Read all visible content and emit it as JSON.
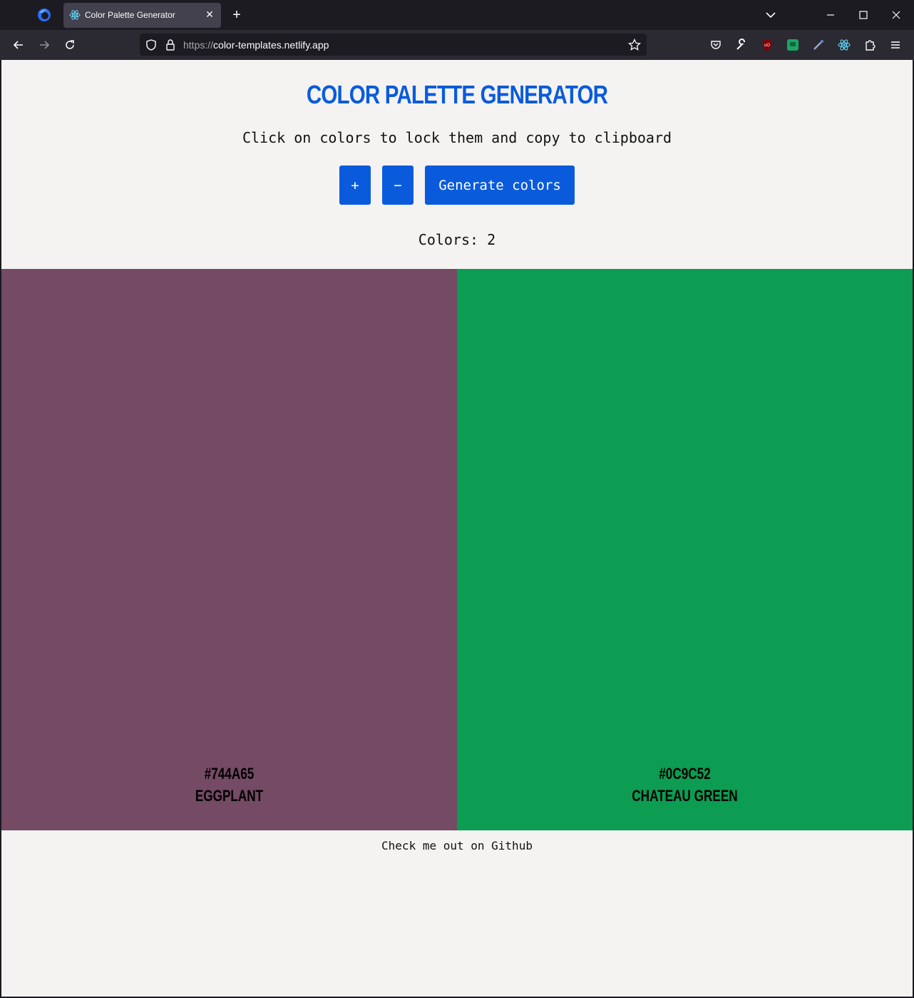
{
  "browser": {
    "tab_title": "Color Palette Generator",
    "url_scheme": "https://",
    "url_host": "color-templates.netlify.app"
  },
  "page": {
    "title": "Color Palette Generator",
    "subtitle": "Click on colors to lock them and copy to clipboard",
    "buttons": {
      "add": "+",
      "remove": "−",
      "generate": "Generate colors"
    },
    "count_label": "Colors:",
    "count_value": "2",
    "swatches": [
      {
        "hex": "#744A65",
        "name": "Eggplant",
        "color": "#744a65"
      },
      {
        "hex": "#0C9C52",
        "name": "Chateau Green",
        "color": "#0c9c52"
      }
    ],
    "footer_link": "Check me out on Github"
  },
  "colors": {
    "accent": "#0a5bdc",
    "page_bg": "#f4f3f1"
  }
}
